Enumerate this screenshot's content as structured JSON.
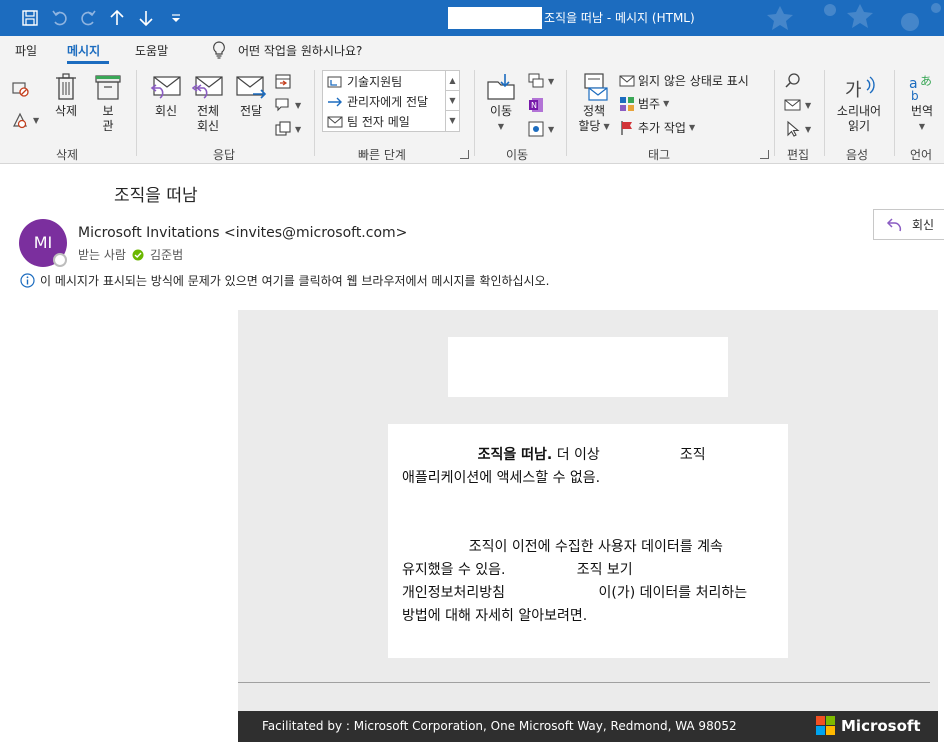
{
  "window": {
    "title": "조직을 떠남 - 메시지 (HTML)",
    "accent_color": "#1c6cbf"
  },
  "quick_access": [
    "save-icon",
    "undo-icon",
    "redo-icon",
    "up-arrow-icon",
    "down-arrow-icon",
    "customize-icon"
  ],
  "tabs": {
    "file": "파일",
    "message": "메시지",
    "help": "도움말",
    "tell_me": "어떤 작업을 원하시나요?"
  },
  "ribbon": {
    "delete_group": {
      "label": "삭제",
      "delete": "삭제",
      "archive_line1": "보",
      "archive_line2": "관"
    },
    "respond_group": {
      "label": "응답",
      "reply": "회신",
      "reply_all_line1": "전체",
      "reply_all_line2": "회신",
      "forward": "전달"
    },
    "quick_steps": {
      "label": "빠른 단계",
      "items": [
        "기술지원팀",
        "관리자에게 전달",
        "팀 전자 메일"
      ]
    },
    "move_group": {
      "label": "이동",
      "move": "이동"
    },
    "tags_group": {
      "label": "태그",
      "assign_policy_line1": "정책",
      "assign_policy_line2": "할당",
      "mark_unread": "읽지 않은 상태로 표시",
      "categorize": "범주",
      "follow_up": "추가 작업"
    },
    "edit_group": {
      "label": "편집"
    },
    "speech_group": {
      "label": "음성",
      "read_aloud_line1": "소리내어",
      "read_aloud_line2": "읽기"
    },
    "language_group": {
      "label": "언어",
      "translate": "번역"
    }
  },
  "message": {
    "subject": "조직을 떠남",
    "avatar_initials": "MI",
    "sender": "Microsoft Invitations <invites@microsoft.com>",
    "to_label": "받는 사람",
    "recipient": "김준범",
    "reply_button": "회신",
    "info_bar": "이 메시지가 표시되는 방식에 문제가 있으면 여기를 클릭하여 웹 브라우저에서 메시지를 확인하십시오."
  },
  "email_body": {
    "line1_bold": "조직을 떠남.",
    "line1_rest": " 더 이상                  조직",
    "line2": "애플리케이션에 액세스할 수 없음.",
    "para2_line1": "               조직이 이전에 수집한 사용자 데이터를 계속",
    "para2_line2": "유지했을 수 있음.                조직 보기",
    "para2_line3": "개인정보처리방침                     이(가) 데이터를 처리하는",
    "para2_line4": "방법에 대해 자세히 알아보려면.",
    "footer": "Facilitated by : Microsoft Corporation, One Microsoft Way, Redmond, WA 98052",
    "brand": "Microsoft",
    "brand_colors": [
      "#f25022",
      "#7fba00",
      "#00a4ef",
      "#ffb900"
    ]
  }
}
